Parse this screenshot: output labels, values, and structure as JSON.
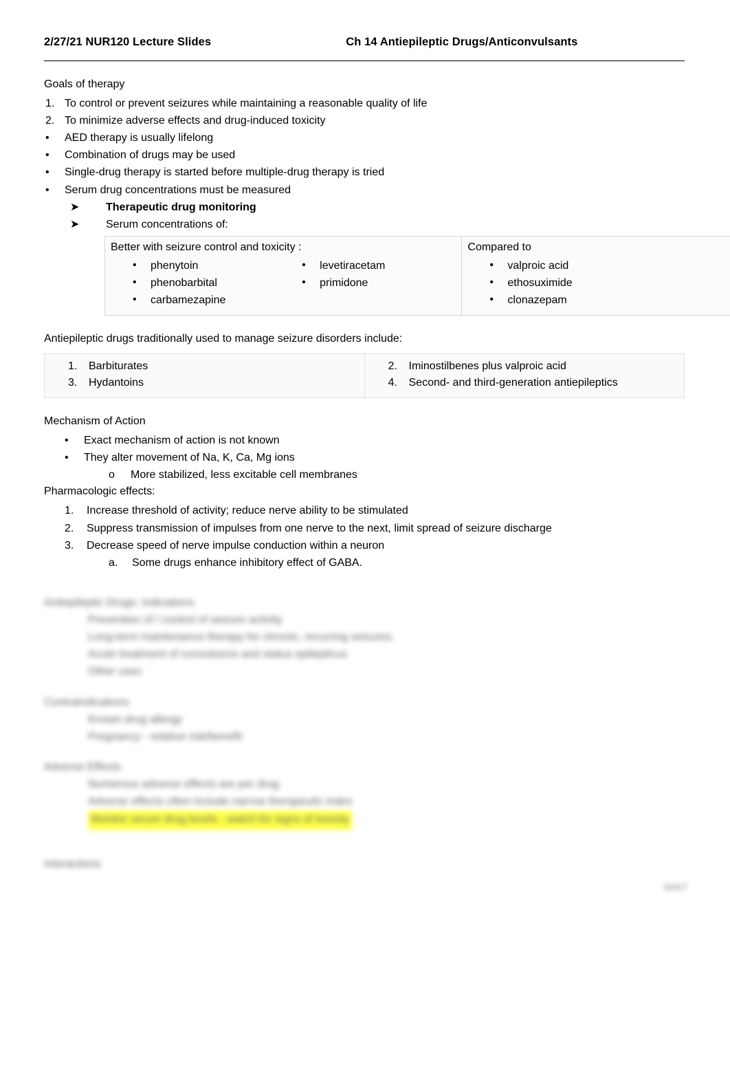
{
  "header": {
    "left": "2/27/21 NUR120 Lecture Slides",
    "center": "Ch 14 Antiepileptic Drugs/Anticonvulsants"
  },
  "goals": {
    "heading": "Goals of therapy",
    "numbered": [
      "To control or prevent seizures while maintaining a reasonable quality of life",
      "To minimize adverse effects and drug-induced toxicity"
    ],
    "bullets": [
      "AED therapy is usually lifelong",
      "Combination of drugs may be used",
      "Single-drug therapy is started before multiple-drug therapy is tried",
      "Serum drug concentrations must be measured"
    ],
    "arrows": [
      "Therapeutic drug monitoring",
      "Serum concentrations of:"
    ]
  },
  "serum_table": {
    "left_header": "Better with seizure control and toxicity :",
    "right_header": "Compared to",
    "left_col1": [
      "phenytoin",
      "phenobarbital",
      "carbamezapine"
    ],
    "left_col2": [
      "levetiracetam",
      "primidone"
    ],
    "right_col": [
      "valproic acid",
      "ethosuximide",
      "clonazepam"
    ]
  },
  "traditional": {
    "intro": "Antiepileptic drugs traditionally used to manage seizure disorders include:",
    "left": [
      {
        "n": "1.",
        "text": "Barbiturates"
      },
      {
        "n": "3.",
        "text": "Hydantoins"
      }
    ],
    "right": [
      {
        "n": "2.",
        "text": "Iminostilbenes plus valproic acid"
      },
      {
        "n": "4.",
        "text": "Second- and third-generation antiepileptics"
      }
    ]
  },
  "moa": {
    "heading": "Mechanism of Action",
    "bullets": [
      "Exact mechanism of action is not known",
      "They alter movement of Na, K, Ca, Mg ions"
    ],
    "sub": "More stabilized, less excitable cell membranes"
  },
  "pharm": {
    "heading": "Pharmacologic effects:",
    "numbered": [
      "Increase threshold of activity; reduce nerve ability to be stimulated",
      "Suppress transmission of impulses from one nerve to the next, limit spread of seizure discharge",
      "Decrease speed of nerve impulse conduction within a neuron"
    ],
    "sub_a": "Some drugs enhance inhibitory effect of GABA."
  },
  "redacted": {
    "section1_heading": "Antiepileptic Drugs: Indications",
    "section1_items": [
      "Prevention of / control of seizure activity",
      "Long-term maintenance therapy for chronic, recurring seizures",
      "Acute treatment of convulsions and status epilepticus",
      "Other uses"
    ],
    "section2_heading": "Contraindications",
    "section2_items": [
      "Known drug allergy",
      "Pregnancy - relative risk/benefit"
    ],
    "section3_heading": "Adverse Effects",
    "section3_items": [
      "Numerous adverse effects are per drug",
      "Adverse effects often include narrow therapeutic index"
    ],
    "section3_highlight": "Monitor serum drug levels - watch for signs of toxicity",
    "section4_heading": "Interactions",
    "footer_mark": "toxic?"
  }
}
